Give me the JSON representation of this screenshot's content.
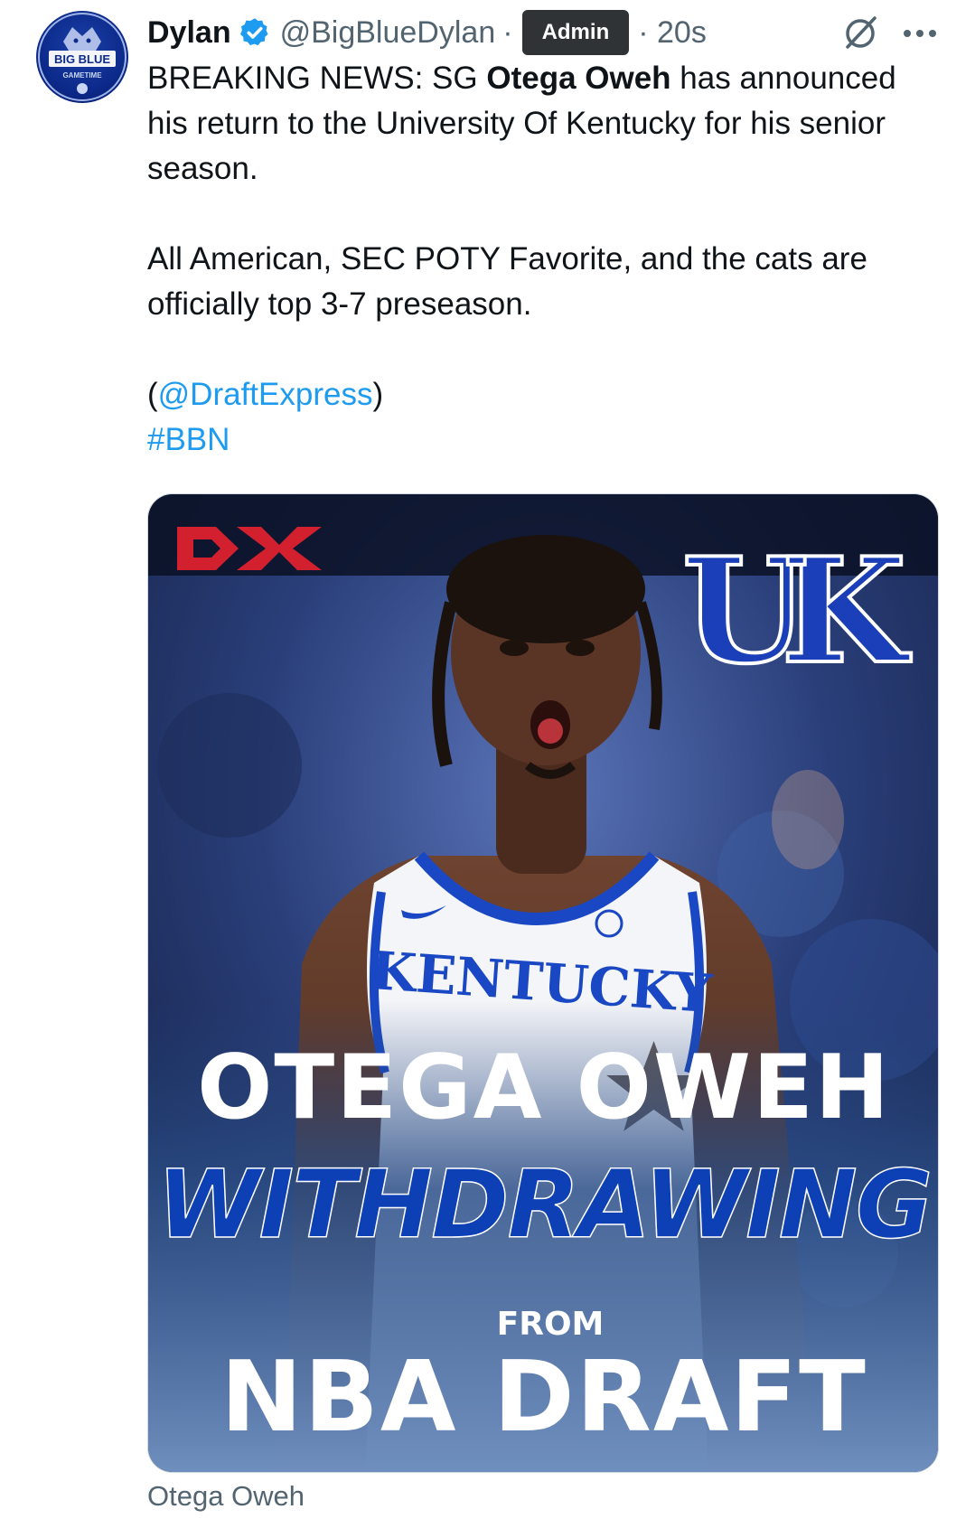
{
  "author": {
    "name": "Dylan",
    "handle": "@BigBlueDylan",
    "separator": "·",
    "badge": "Admin",
    "time": "· 20s",
    "avatar_text_top": "BIG BLUE",
    "avatar_text_bottom": "GAMETIME"
  },
  "tweet": {
    "line1_pre": "BREAKING NEWS: SG ",
    "line1_bold": "Otega Oweh",
    "line1_post": " has announced his return to the University Of Kentucky for his senior season.",
    "para2": "All American, SEC POTY Favorite, and the cats are officially top 3-7 preseason.",
    "para3_open": "(",
    "para3_mention": "@DraftExpress",
    "para3_close": ")",
    "hashtag": "#BBN"
  },
  "media": {
    "corner_logo_left": "DX",
    "corner_logo_right": "UK",
    "jersey_text": "KENTUCKY",
    "headline_name": "OTEGA OWEH",
    "headline_action": "WITHDRAWING",
    "headline_from": "FROM",
    "headline_event": "NBA DRAFT"
  },
  "caption": "Otega Oweh",
  "colors": {
    "link": "#1d9bf0",
    "verified": "#1d9bf0",
    "uk_blue": "#0033a0",
    "dx_red": "#d2202f"
  },
  "icons": [
    "verified-badge-icon",
    "grok-icon",
    "more-options-icon"
  ]
}
